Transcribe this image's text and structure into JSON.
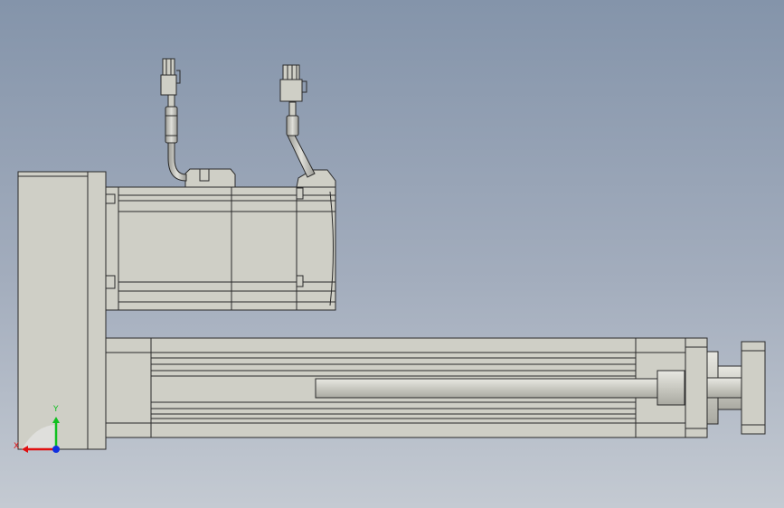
{
  "axes": {
    "x_label": "X",
    "y_label": "Y",
    "colors": {
      "x": "#e01010",
      "y": "#10c020",
      "z": "#1030e0"
    }
  },
  "model": {
    "body_fill": "#cfcfc6",
    "body_shade": "#bdbdb4",
    "edge_color": "#2a2a2a"
  }
}
